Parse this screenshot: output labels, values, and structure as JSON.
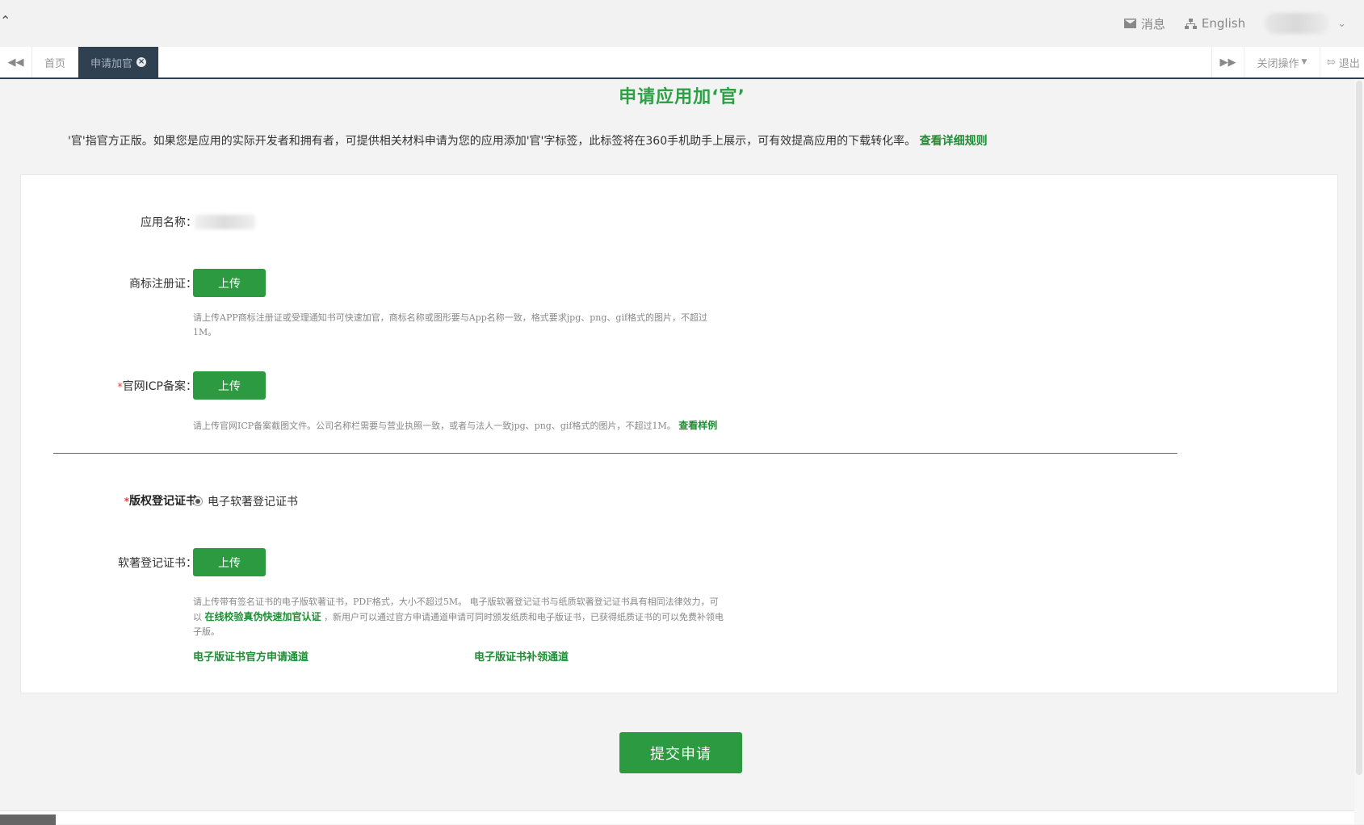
{
  "header": {
    "messages_label": "消息",
    "language_label": "English",
    "user_chevron": "⌄"
  },
  "tabbar": {
    "tabs": [
      {
        "label": "首页",
        "active": false
      },
      {
        "label": "申请加官",
        "active": true
      }
    ],
    "close_ops_label": "关闭操作",
    "exit_label": "退出"
  },
  "page": {
    "title": "申请应用加‘官’",
    "intro_text": "'官'指官方正版。如果您是应用的实际开发者和拥有者，可提供相关材料申请为您的应用添加'官'字标签，此标签将在360手机助手上展示，可有效提高应用的下载转化率。",
    "intro_link": "查看详细规则"
  },
  "form": {
    "app_name_label": "应用名称：",
    "trademark": {
      "label": "商标注册证：",
      "button": "上传",
      "hint": "请上传APP商标注册证或受理通知书可快速加官，商标名称或图形要与App名称一致，格式要求jpg、png、gif格式的图片，不超过1M。"
    },
    "icp": {
      "required_mark": "*",
      "label": "官网ICP备案：",
      "button": "上传",
      "hint": "请上传官网ICP备案截图文件。公司名称栏需要与营业执照一致，或者与法人一致jpg、png、gif格式的图片，不超过1M。",
      "hint_link": "查看样例"
    },
    "copyright": {
      "required_mark": "*",
      "label": "版权登记证书",
      "radio_option": "电子软著登记证书"
    },
    "software_cert": {
      "label": "软著登记证书：",
      "button": "上传",
      "hint_part1": "请上传带有签名证书的电子版软著证书，PDF格式，大小不超过5M。 电子版软著登记证书与纸质软著登记证书具有相同法律效力，可以",
      "hint_link": "在线校验真伪快速加官认证",
      "hint_part2": "，新用户可以通过官方申请通道申请可同时颁发纸质和电子版证书，已获得纸质证书的可以免费补领电子版。",
      "link_official": "电子版证书官方申请通道",
      "link_reissue": "电子版证书补领通道"
    }
  },
  "submit_label": "提交申请",
  "colors": {
    "accent_green": "#2b9a40",
    "tab_active_bg": "#2f4050",
    "title_green": "#2ea046"
  }
}
